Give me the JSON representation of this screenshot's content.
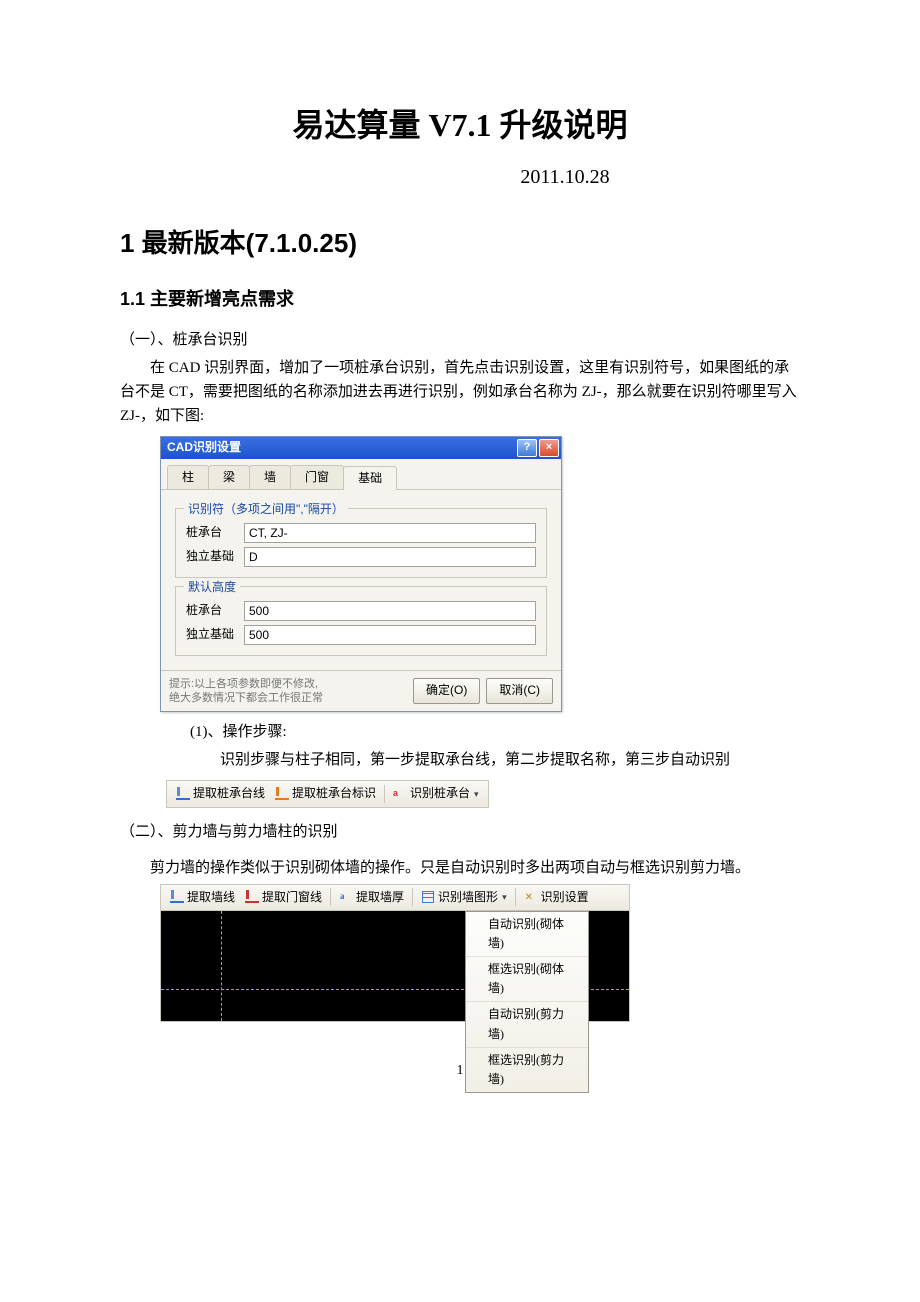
{
  "doc": {
    "title": "易达算量 V7.1 升级说明",
    "date": "2011.10.28"
  },
  "sec1": {
    "heading": "1 最新版本(7.1.0.25)",
    "sub1": "1.1 主要新增亮点需求",
    "p1": "（一）、桩承台识别",
    "p2": "在 CAD 识别界面，增加了一项桩承台识别，首先点击识别设置，这里有识别符号，如果图纸的承台不是 CT，需要把图纸的名称添加进去再进行识别，例如承台名称为 ZJ-，那么就要在识别符哪里写入 ZJ-，如下图:"
  },
  "dlg": {
    "title": "CAD识别设置",
    "tabs": [
      "柱",
      "梁",
      "墙",
      "门窗",
      "基础"
    ],
    "active_tab": 4,
    "group1": {
      "title": "识别符（多项之间用\",\"隔开）",
      "rows": [
        {
          "label": "桩承台",
          "value": "CT, ZJ-"
        },
        {
          "label": "独立基础",
          "value": "D"
        }
      ]
    },
    "group2": {
      "title": "默认高度",
      "rows": [
        {
          "label": "桩承台",
          "value": "500"
        },
        {
          "label": "独立基础",
          "value": "500"
        }
      ]
    },
    "hint_l1": "提示:以上各项参数即便不修改,",
    "hint_l2": "绝大多数情况下都会工作很正常",
    "ok": "确定(O)",
    "cancel": "取消(C)"
  },
  "steps": {
    "h": "(1)、操作步骤:",
    "t": "识别步骤与柱子相同，第一步提取承台线，第二步提取名称，第三步自动识别"
  },
  "tb1": {
    "b1": "提取桩承台线",
    "b2": "提取桩承台标识",
    "b3": "识别桩承台"
  },
  "part2": {
    "h": "（二）、剪力墙与剪力墙柱的识别",
    "p": "剪力墙的操作类似于识别砌体墙的操作。只是自动识别时多出两项自动与框选识别剪力墙。"
  },
  "tb2": {
    "b1": "提取墙线",
    "b2": "提取门窗线",
    "b3": "提取墙厚",
    "b4": "识别墙图形",
    "b5": "识别设置",
    "menu": [
      "自动识别(砌体墙)",
      "框选识别(砌体墙)",
      "自动识别(剪力墙)",
      "框选识别(剪力墙)"
    ]
  },
  "page": "1"
}
